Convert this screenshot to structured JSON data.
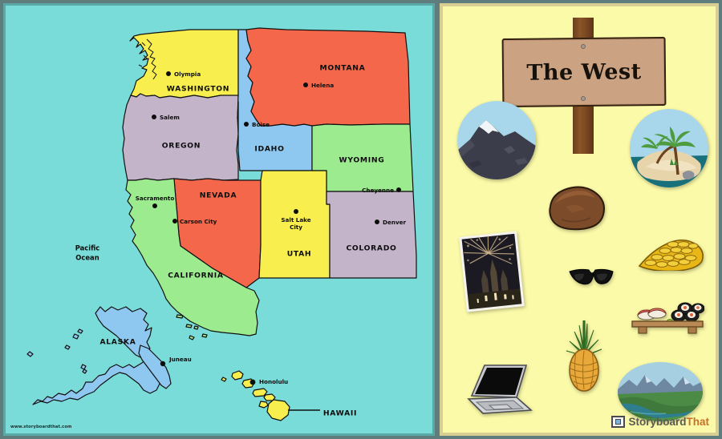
{
  "poster": {
    "title": "The West",
    "watermark": "www.storyboardthat.com",
    "logo": {
      "part1": "Storyboard",
      "part2": "That"
    }
  },
  "map": {
    "ocean_label": "Pacific\nOcean",
    "ocean_label_line1": "Pacific",
    "ocean_label_line2": "Ocean",
    "background_color": "#79dcd8",
    "states": [
      {
        "name": "WASHINGTON",
        "color": "#f8ef4f",
        "capital": "Olympia"
      },
      {
        "name": "OREGON",
        "color": "#c3b4c9",
        "capital": "Salem"
      },
      {
        "name": "IDAHO",
        "color": "#8ec7ef",
        "capital": "Boise"
      },
      {
        "name": "MONTANA",
        "color": "#f4674a",
        "capital": "Helena"
      },
      {
        "name": "WYOMING",
        "color": "#9ceb8e",
        "capital": "Cheyenne"
      },
      {
        "name": "NEVADA",
        "color": "#f4674a",
        "capital": "Carson City"
      },
      {
        "name": "UTAH",
        "color": "#f8ef4f",
        "capital": "Salt Lake City"
      },
      {
        "name": "COLORADO",
        "color": "#c3b4c9",
        "capital": "Denver"
      },
      {
        "name": "CALIFORNIA",
        "color": "#9ceb8e",
        "capital": "Sacramento"
      },
      {
        "name": "ALASKA",
        "color": "#8ec7ef",
        "capital": "Juneau"
      },
      {
        "name": "HAWAII",
        "color": "#f8ef4f",
        "capital": "Honolulu"
      }
    ],
    "capital_labels": {
      "olympia": "Olympia",
      "salem": "Salem",
      "boise": "Boise",
      "helena": "Helena",
      "cheyenne": "Cheyenne",
      "carson_city": "Carson City",
      "salt_lake_city_l1": "Salt Lake",
      "salt_lake_city_l2": "City",
      "denver": "Denver",
      "sacramento": "Sacramento",
      "juneau": "Juneau",
      "honolulu": "Honolulu"
    },
    "state_labels": {
      "washington": "WASHINGTON",
      "oregon": "OREGON",
      "idaho": "IDAHO",
      "montana": "MONTANA",
      "wyoming": "WYOMING",
      "nevada": "NEVADA",
      "utah": "UTAH",
      "colorado": "COLORADO",
      "california": "CALIFORNIA",
      "alaska": "ALASKA",
      "hawaii": "HAWAII"
    }
  },
  "collage": {
    "items": [
      {
        "id": "mountain-photo",
        "name": "snow-capped-mountain"
      },
      {
        "id": "island-photo",
        "name": "palm-tree-island"
      },
      {
        "id": "rock",
        "name": "brown-rock"
      },
      {
        "id": "fireworks-photo",
        "name": "fireworks-castle-photo"
      },
      {
        "id": "gold-coins",
        "name": "pile-of-gold-coins"
      },
      {
        "id": "sunglasses",
        "name": "black-sunglasses"
      },
      {
        "id": "sushi",
        "name": "sushi-on-board"
      },
      {
        "id": "pineapple",
        "name": "pineapple"
      },
      {
        "id": "laptop",
        "name": "open-laptop"
      },
      {
        "id": "valley-photo",
        "name": "mountain-river-valley"
      }
    ]
  }
}
